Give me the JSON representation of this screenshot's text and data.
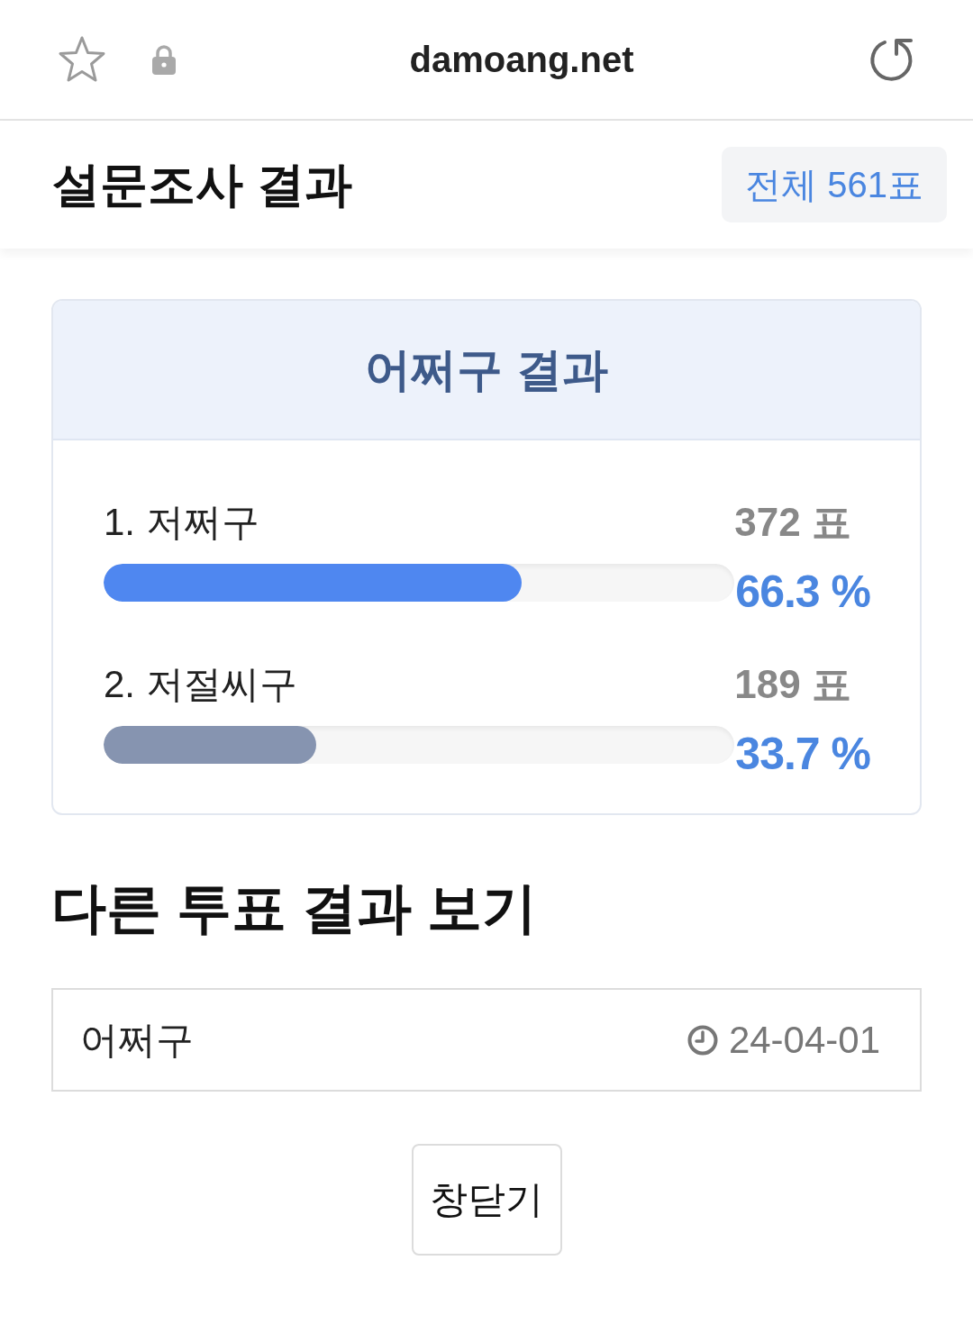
{
  "browser_bar": {
    "url": "damoang.net"
  },
  "header": {
    "title": "설문조사 결과",
    "total_badge": "전체 561표"
  },
  "poll": {
    "title": "어쩌구 결과",
    "options": [
      {
        "label": "1. 저쩌구",
        "votes": "372 표",
        "percent": "66.3 %",
        "level": 0.663,
        "color": "#4f87f0"
      },
      {
        "label": "2. 저절씨구",
        "votes": "189 표",
        "percent": "33.7 %",
        "level": 0.337,
        "color": "#8694b0"
      }
    ]
  },
  "other_polls": {
    "heading": "다른 투표 결과 보기",
    "items": [
      {
        "title": "어쩌구",
        "date": "24-04-01"
      }
    ]
  },
  "close_button": "창닫기"
}
